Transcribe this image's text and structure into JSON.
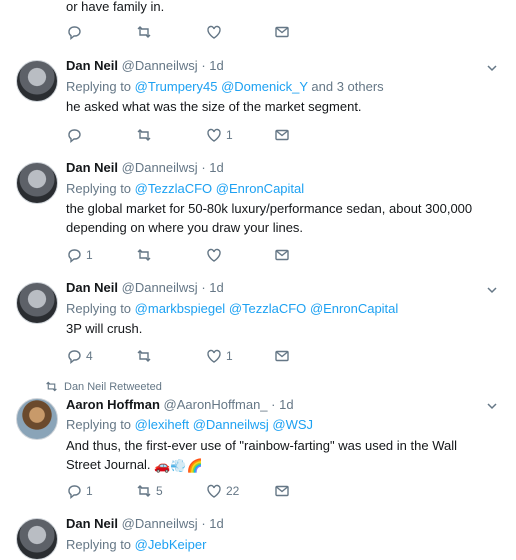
{
  "top_fragment": {
    "text": "or have family in."
  },
  "tweets": [
    {
      "name": "Dan Neil",
      "handle": "@Danneilwsj",
      "time": "· 1d",
      "reply_prefix": "Replying to",
      "reply_links": [
        "@Trumpery45",
        "@Domenick_Y"
      ],
      "reply_suffix": "and 3 others",
      "text": "he asked what was the size of the market segment.",
      "reply_count": "",
      "retweet_count": "",
      "like_count": "1"
    },
    {
      "name": "Dan Neil",
      "handle": "@Danneilwsj",
      "time": "· 1d",
      "reply_prefix": "Replying to",
      "reply_links": [
        "@TezzlaCFO",
        "@EnronCapital"
      ],
      "reply_suffix": "",
      "text": "the global market for 50-80k luxury/performance sedan, about 300,000 depending on where you draw your lines.",
      "reply_count": "1",
      "retweet_count": "",
      "like_count": ""
    },
    {
      "name": "Dan Neil",
      "handle": "@Danneilwsj",
      "time": "· 1d",
      "reply_prefix": "Replying to",
      "reply_links": [
        "@markbspiegel",
        "@TezzlaCFO",
        "@EnronCapital"
      ],
      "reply_suffix": "",
      "text": "3P will crush.",
      "reply_count": "4",
      "retweet_count": "",
      "like_count": "1"
    },
    {
      "retweeted_by": "Dan Neil Retweeted",
      "name": "Aaron Hoffman",
      "handle": "@AaronHoffman_",
      "time": "· 1d",
      "reply_prefix": "Replying to",
      "reply_links": [
        "@lexiheft",
        "@Danneilwsj",
        "@WSJ"
      ],
      "reply_suffix": "",
      "text": "And thus, the first-ever use of \"rainbow-farting\" was used in the Wall Street Journal.",
      "emoji": "🚗💨🌈",
      "reply_count": "1",
      "retweet_count": "5",
      "like_count": "22"
    },
    {
      "name": "Dan Neil",
      "handle": "@Danneilwsj",
      "time": "· 1d",
      "reply_prefix": "Replying to",
      "reply_links": [
        "@JebKeiper"
      ],
      "reply_suffix": ""
    }
  ],
  "colors": {
    "link": "#1da1f2",
    "muted": "#657786",
    "text": "#14171a",
    "border": "#e6ecf0"
  }
}
